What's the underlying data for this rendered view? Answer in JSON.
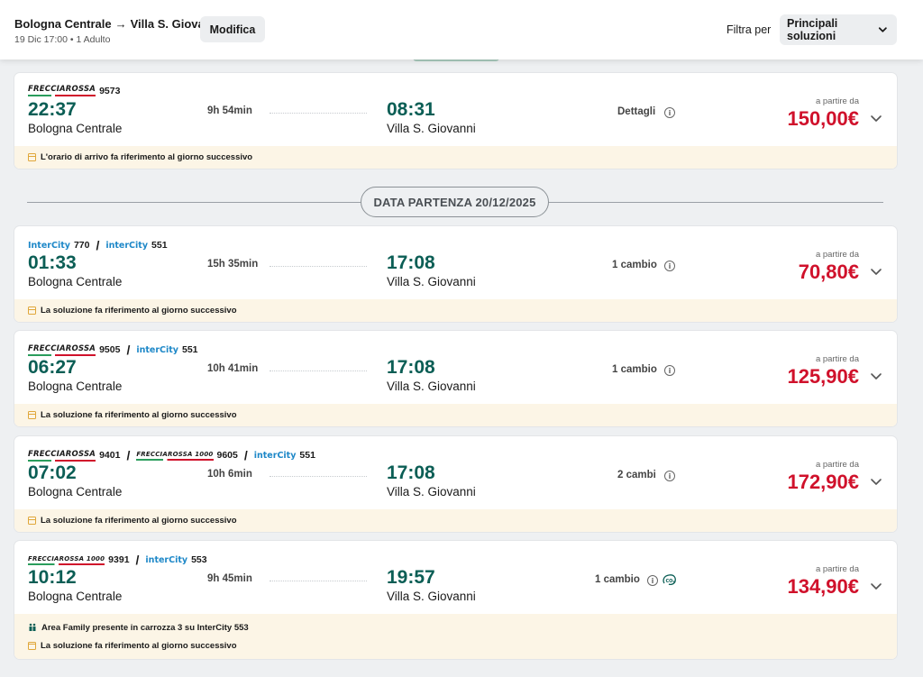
{
  "header": {
    "route_from": "Bologna Centrale",
    "route_to": "Villa S. Giovanni",
    "sub": "19 Dic 17:00 • 1 Adulto",
    "edit_label": "Modifica",
    "filter_label": "Filtra per",
    "filter_value": "Principali soluzioni"
  },
  "date_divider": "DATA PARTENZA 20/12/2025",
  "solutions": [
    {
      "trains": [
        {
          "brand": "FRECCIAROSSA",
          "number": "9573"
        }
      ],
      "dep_time": "22:37",
      "dep_station": "Bologna Centrale",
      "duration": "9h 54min",
      "arr_time": "08:31",
      "arr_station": "Villa S. Giovanni",
      "changes": "Dettagli",
      "from_label": "a partire da",
      "price": "150,00€",
      "notices": [
        "L'orario di arrivo fa riferimento al giorno successivo"
      ]
    },
    {
      "trains": [
        {
          "brand": "InterCity",
          "number": "770"
        },
        {
          "brand": "interCity",
          "number": "551"
        }
      ],
      "dep_time": "01:33",
      "dep_station": "Bologna Centrale",
      "duration": "15h 35min",
      "arr_time": "17:08",
      "arr_station": "Villa S. Giovanni",
      "changes": "1 cambio",
      "from_label": "a partire da",
      "price": "70,80€",
      "notices": [
        "La soluzione fa riferimento al giorno successivo"
      ]
    },
    {
      "trains": [
        {
          "brand": "FRECCIAROSSA",
          "number": "9505"
        },
        {
          "brand": "interCity",
          "number": "551"
        }
      ],
      "dep_time": "06:27",
      "dep_station": "Bologna Centrale",
      "duration": "10h 41min",
      "arr_time": "17:08",
      "arr_station": "Villa S. Giovanni",
      "changes": "1 cambio",
      "from_label": "a partire da",
      "price": "125,90€",
      "notices": [
        "La soluzione fa riferimento al giorno successivo"
      ]
    },
    {
      "trains": [
        {
          "brand": "FRECCIAROSSA",
          "number": "9401"
        },
        {
          "brand": "FRECCIAROSSA 1000",
          "number": "9605"
        },
        {
          "brand": "interCity",
          "number": "551"
        }
      ],
      "dep_time": "07:02",
      "dep_station": "Bologna Centrale",
      "duration": "10h 6min",
      "arr_time": "17:08",
      "arr_station": "Villa S. Giovanni",
      "changes": "2 cambi",
      "from_label": "a partire da",
      "price": "172,90€",
      "notices": [
        "La soluzione fa riferimento al giorno successivo"
      ]
    },
    {
      "trains": [
        {
          "brand": "FRECCIAROSSA 1000",
          "number": "9391"
        },
        {
          "brand": "interCity",
          "number": "553"
        }
      ],
      "dep_time": "10:12",
      "dep_station": "Bologna Centrale",
      "duration": "9h 45min",
      "arr_time": "19:57",
      "arr_station": "Villa S. Giovanni",
      "changes": "1 cambio",
      "co2_icon": "co2-leaf-icon",
      "from_label": "a partire da",
      "price": "134,90€",
      "family_notice": "Area Family presente in carrozza 3 su InterCity 553",
      "notices": [
        "La soluzione fa riferimento al giorno successivo"
      ]
    }
  ],
  "icons": {
    "notice": "calendar-icon",
    "family": "family-icon",
    "info": "info-icon",
    "expand": "chevron-down-icon"
  },
  "colors": {
    "time": "#0b5e55",
    "price": "#d0112b",
    "notice_bg": "#fcf5e6",
    "frecciarossa_red": "#d0112b",
    "intercity_blue": "#1e88c8"
  }
}
